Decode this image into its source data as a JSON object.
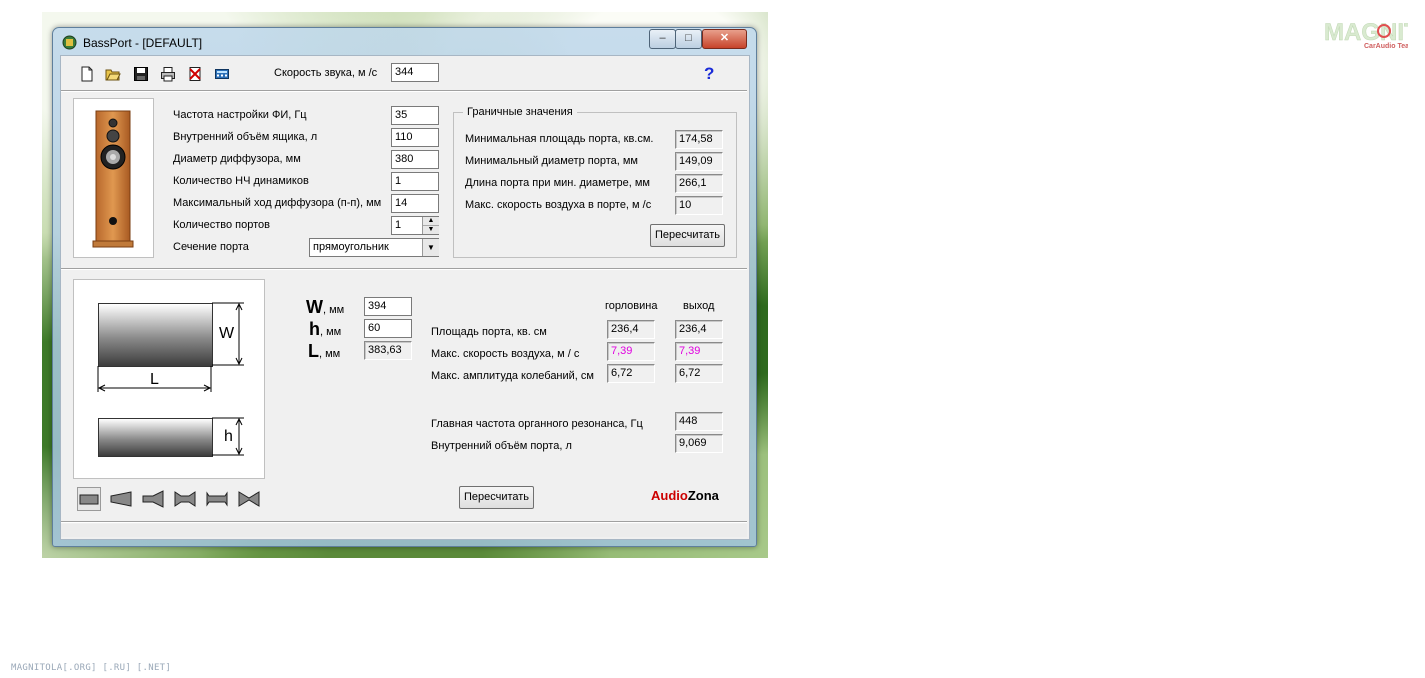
{
  "window": {
    "title": "BassPort - [DEFAULT]"
  },
  "toolbar": {
    "sound_speed_label": "Скорость звука, м /с",
    "sound_speed_value": "344",
    "help_label": "?"
  },
  "params": {
    "fi_freq": {
      "label": "Частота настройки ФИ, Гц",
      "value": "35"
    },
    "box_volume": {
      "label": "Внутренний объём ящика, л",
      "value": "110"
    },
    "cone_diameter": {
      "label": "Диаметр диффузора, мм",
      "value": "380"
    },
    "woofer_count": {
      "label": "Количество НЧ динамиков",
      "value": "1"
    },
    "max_excursion": {
      "label": "Максимальный ход диффузора (п-п), мм",
      "value": "14"
    },
    "port_count": {
      "label": "Количество портов",
      "value": "1"
    },
    "port_section": {
      "label": "Сечение порта",
      "value": "прямоугольник"
    }
  },
  "limits": {
    "title": "Граничные значения",
    "min_area": {
      "label": "Минимальная площадь порта, кв.см.",
      "value": "174,58"
    },
    "min_diameter": {
      "label": "Минимальный диаметр порта, мм",
      "value": "149,09"
    },
    "length_min_diam": {
      "label": "Длина порта при мин. диаметре, мм",
      "value": "266,1"
    },
    "max_air_speed": {
      "label": "Макс. скорость воздуха в порте, м /с",
      "value": "10"
    },
    "recalc_label": "Пересчитать"
  },
  "diagram": {
    "w": "W",
    "l": "L",
    "h": "h"
  },
  "dims": {
    "w": {
      "letter": "W",
      "unit": ", мм",
      "value": "394"
    },
    "h": {
      "letter": "h",
      "unit": ", мм",
      "value": "60"
    },
    "l": {
      "letter": "L",
      "unit": ", мм",
      "value": "383,63"
    }
  },
  "results": {
    "col_throat": "горловина",
    "col_exit": "выход",
    "area": {
      "label": "Площадь порта, кв. см",
      "throat": "236,4",
      "exit": "236,4"
    },
    "air_speed": {
      "label": "Макс. скорость воздуха, м / с",
      "throat": "7,39",
      "exit": "7,39"
    },
    "amplitude": {
      "label": "Макс. амплитуда колебаний, см",
      "throat": "6,72",
      "exit": "6,72"
    },
    "organ_freq": {
      "label": "Главная частота органного резонанса, Гц",
      "value": "448"
    },
    "port_volume": {
      "label": "Внутренний объём порта, л",
      "value": "9,069"
    },
    "recalc_label": "Пересчитать"
  },
  "brand": {
    "audio": "Audio",
    "zona": "Zona"
  },
  "colors": {
    "accent_red": "#cc0000",
    "speed_magenta": "#e000e0",
    "help_blue": "#1a2bd8"
  },
  "watermark": {
    "text": "MAGNITOLA[.ORG] [.RU] [.NET]"
  }
}
